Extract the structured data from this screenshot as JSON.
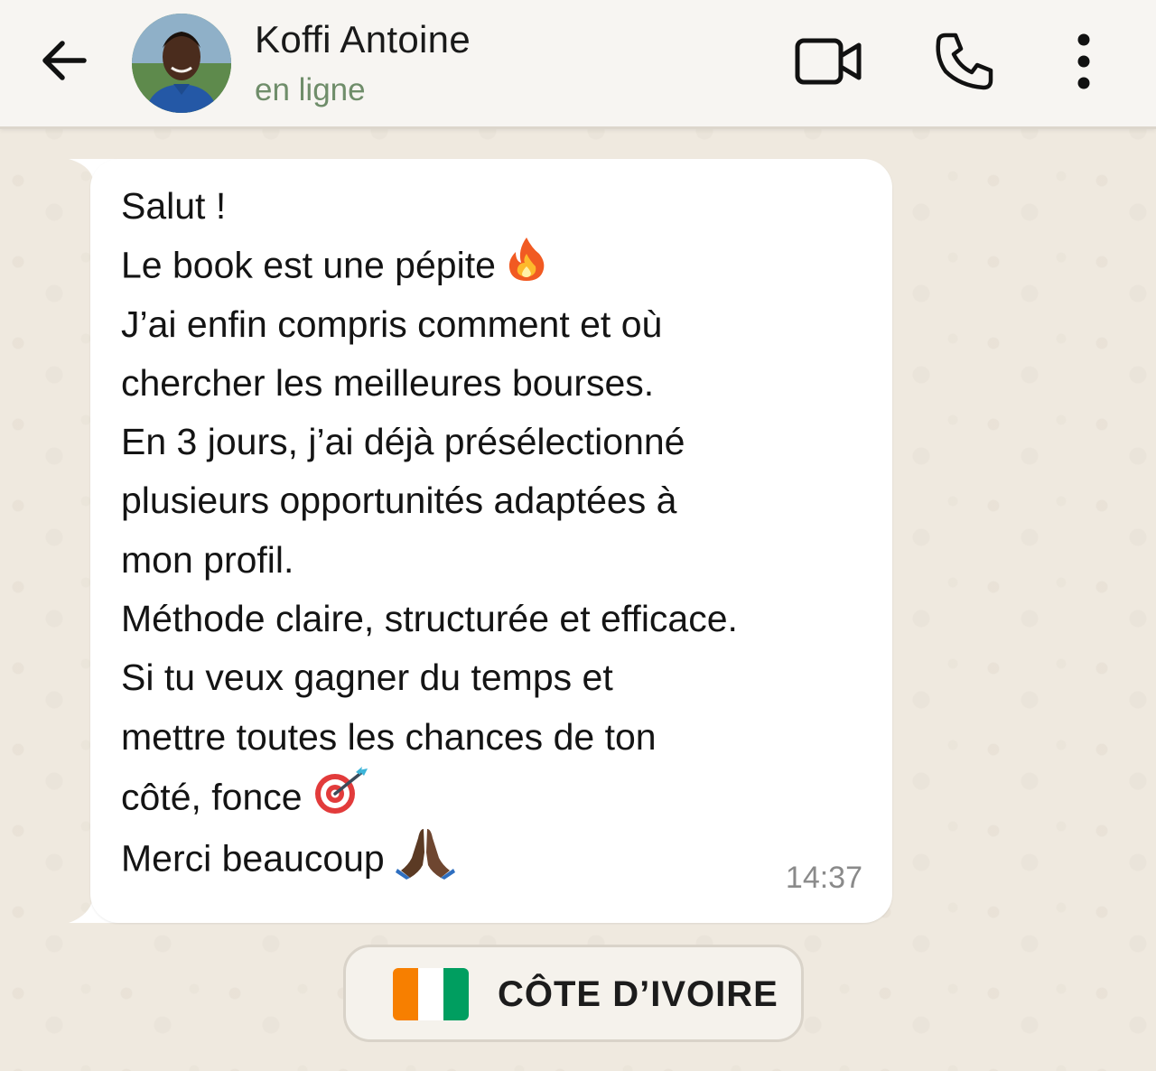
{
  "header": {
    "contact_name": "Koffi Antoine",
    "status": "en ligne",
    "icons": {
      "back": "arrow-left-icon",
      "video": "video-camera-icon",
      "call": "phone-icon",
      "menu": "more-vertical-icon"
    }
  },
  "message": {
    "lines": [
      "Salut !",
      "Le book est une pépite",
      "J’ai enfin compris comment et où",
      "chercher les meilleures bourses.",
      "En 3 jours, j’ai déjà présélectionné",
      "plusieurs opportunités adaptées à",
      "mon profil.",
      "Méthode claire, structurée et efficace.",
      "Si tu veux gagner du temps et",
      "mettre toutes les chances de ton",
      "côté, fonce",
      "Merci beaucoup"
    ],
    "emojis": {
      "line2": "fire-emoji",
      "line11": "target-emoji",
      "line12": "praying-hands-emoji"
    },
    "time": "14:37"
  },
  "country": {
    "name": "CÔTE D’IVOIRE",
    "flag_colors": [
      "#f77f00",
      "#ffffff",
      "#009e60"
    ]
  },
  "colors": {
    "background": "#efe9df",
    "header_bg": "#f7f5f2",
    "bubble_bg": "#ffffff",
    "status_green": "#6f8d6a"
  }
}
